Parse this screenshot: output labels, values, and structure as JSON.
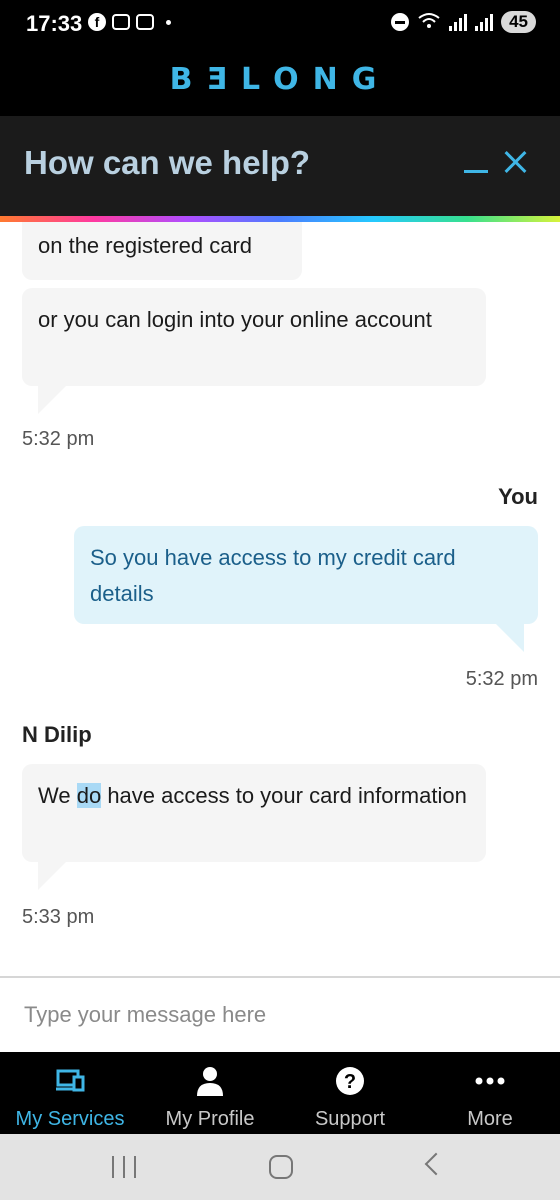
{
  "status_bar": {
    "time": "17:33",
    "battery": "45",
    "icons": [
      "facebook-icon",
      "message-icon",
      "message-icon",
      "dot-icon",
      "dnd-icon",
      "wifi-icon",
      "signal-icon",
      "signal-icon"
    ]
  },
  "brand": {
    "logo_text": "BƎLONG",
    "color": "#3fb6e6"
  },
  "chat_header": {
    "title": "How can we help?"
  },
  "messages": {
    "m1": {
      "text": "on the registered card"
    },
    "m2": {
      "text": "or you can login into your online account"
    },
    "t1": "5:32 pm",
    "user_label": "You",
    "m3": {
      "text": "So you have access to my credit card details"
    },
    "t2": "5:32 pm",
    "agent_name": "N Dilip",
    "m4": {
      "before": "We ",
      "highlight": "do",
      "after": " have access to your card information"
    },
    "t3": "5:33 pm"
  },
  "input": {
    "placeholder": "Type your message here"
  },
  "tabs": [
    {
      "label": "My Services",
      "icon": "laptop-icon",
      "active": true
    },
    {
      "label": "My Profile",
      "icon": "person-icon",
      "active": false
    },
    {
      "label": "Support",
      "icon": "question-icon",
      "active": false
    },
    {
      "label": "More",
      "icon": "more-dots-icon",
      "active": false
    }
  ],
  "colors": {
    "accent": "#3fb6e6",
    "user_bubble": "#e0f3fa",
    "agent_bubble": "#f5f5f5"
  }
}
